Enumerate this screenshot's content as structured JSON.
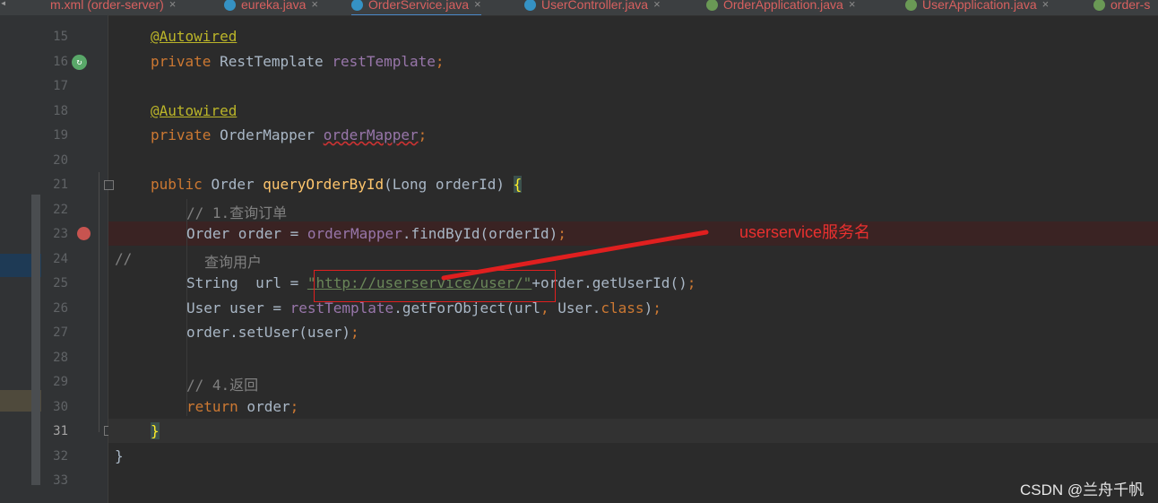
{
  "tabs": [
    {
      "label": "m.xml (order-server)",
      "color": "red",
      "icon": "maven-icon"
    },
    {
      "label": "eureka.java",
      "color": "red",
      "icon": "class-icon"
    },
    {
      "label": "OrderService.java",
      "color": "red",
      "icon": "class-icon",
      "active": true
    },
    {
      "label": "UserController.java",
      "color": "red",
      "icon": "class-icon"
    },
    {
      "label": "OrderApplication.java",
      "color": "red",
      "icon": "spring-class-icon"
    },
    {
      "label": "UserApplication.java",
      "color": "red",
      "icon": "spring-class-icon"
    },
    {
      "label": "order-s",
      "color": "red",
      "icon": "spring-class-icon"
    }
  ],
  "close_glyph": "×",
  "line_numbers": [
    "15",
    "16",
    "17",
    "18",
    "19",
    "20",
    "21",
    "22",
    "23",
    "24",
    "25",
    "26",
    "27",
    "28",
    "29",
    "30",
    "31",
    "32",
    "33"
  ],
  "current_line": "31",
  "breakpoint_line": "23",
  "code": {
    "l15_annotation": "@Autowired",
    "l16_private": "private",
    "l16_type": "RestTemplate",
    "l16_field": "restTemplate",
    "l16_semi": ";",
    "l18_annotation": "@Autowired",
    "l19_private": "private",
    "l19_type": "OrderMapper",
    "l19_field": "orderMapper",
    "l19_semi": ";",
    "l21_public": "public",
    "l21_type": "Order",
    "l21_method": "queryOrderById",
    "l21_params": "(Long orderId)",
    "l21_brace": "{",
    "l22_comment": "// 1.查询订单",
    "l23_prefix": "Order order = ",
    "l23_field": "orderMapper",
    "l23_call": ".findById(orderId)",
    "l23_semi": ";",
    "l24_comment_slashes": "//",
    "l24_comment_text": "查询用户",
    "l25_prefix": "String  url = ",
    "l25_string": "\"http://userservice/user/\"",
    "l25_suffix": "+order.getUserId()",
    "l25_semi": ";",
    "l26_prefix": "User user = ",
    "l26_field": "restTemplate",
    "l26_call": ".getForObject(url",
    "l26_comma": ", ",
    "l26_user": "User.",
    "l26_class": "class",
    "l26_close": ")",
    "l26_semi": ";",
    "l27_call": "order.setUser(user)",
    "l27_semi": ";",
    "l29_comment": "// 4.返回",
    "l30_return": "return",
    "l30_rest": " order",
    "l30_semi": ";",
    "l31_brace": "}",
    "l32_brace": "}"
  },
  "annotation_text": "userservice服务名",
  "watermark": "CSDN @兰舟千帆",
  "colors": {
    "editor_bg": "#2b2b2b",
    "annotation_red": "#e9302f",
    "breakpoint": "#c75450",
    "keyword": "#cc7832",
    "string": "#6a8759",
    "field": "#9876aa",
    "method": "#ffc66d"
  }
}
